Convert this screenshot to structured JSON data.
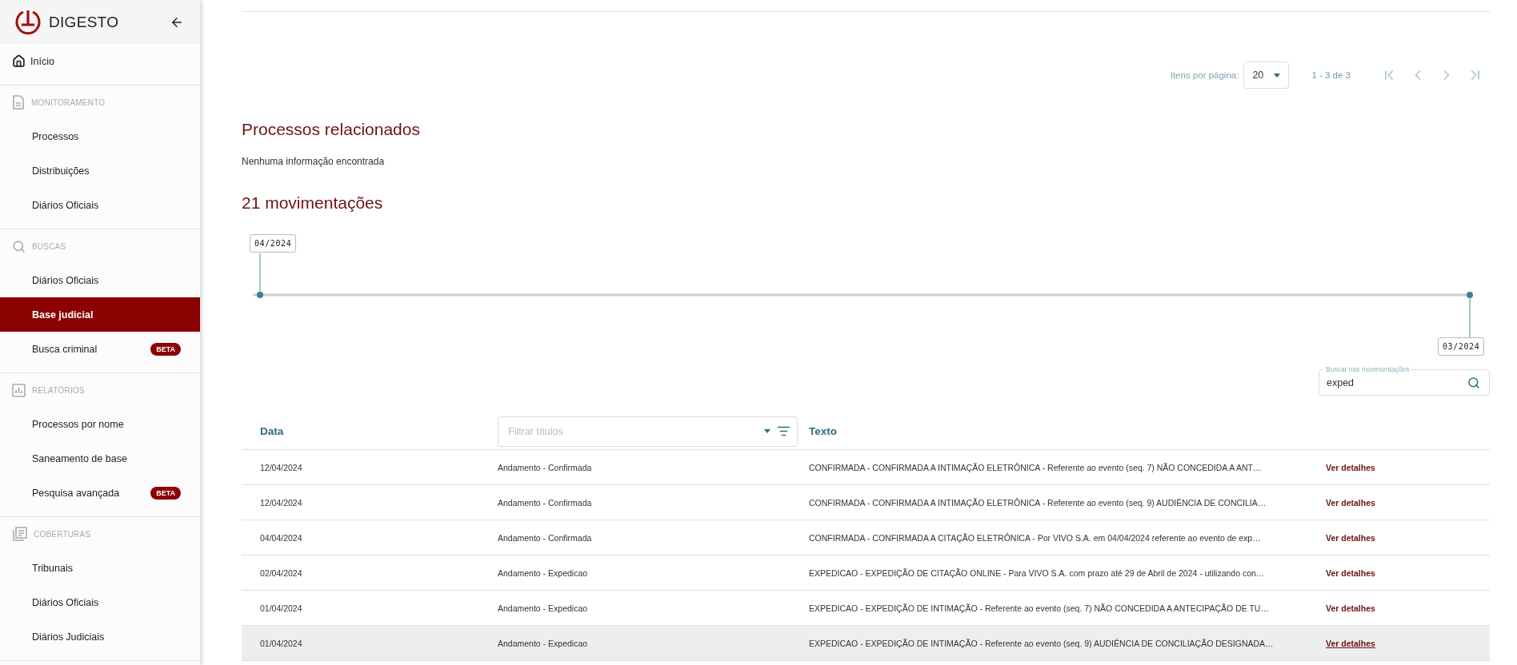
{
  "sidebar": {
    "brand": "DIGESTO",
    "home": {
      "label": "Início",
      "selected": false
    },
    "sections": [
      {
        "title": "MONITORAMENTO",
        "items": [
          {
            "label": "Processos",
            "selected": false
          },
          {
            "label": "Distribuições",
            "selected": false
          },
          {
            "label": "Diários Oficiais",
            "selected": false
          }
        ]
      },
      {
        "title": "BUSCAS",
        "items": [
          {
            "label": "Diários Oficiais",
            "selected": false
          },
          {
            "label": "Base judicial",
            "selected": true
          },
          {
            "label": "Busca criminal",
            "selected": false,
            "badge": "BETA"
          }
        ]
      },
      {
        "title": "RELATÓRIOS",
        "items": [
          {
            "label": "Processos por nome",
            "selected": false
          },
          {
            "label": "Saneamento de base",
            "selected": false
          },
          {
            "label": "Pesquisa avançada",
            "selected": false,
            "badge": "BETA"
          }
        ]
      },
      {
        "title": "COBERTURAS",
        "items": [
          {
            "label": "Tribunais",
            "selected": false
          },
          {
            "label": "Diários Oficiais",
            "selected": false
          },
          {
            "label": "Diários Judiciais",
            "selected": false
          }
        ]
      }
    ]
  },
  "pagination": {
    "label": "Itens por página:",
    "page_size": "20",
    "range": "1 - 3 de 3"
  },
  "related": {
    "title": "Processos relacionados",
    "empty_text": "Nenhuma informação encontrada"
  },
  "movements": {
    "title": "21 movimentações",
    "timeline": {
      "start_label": "04/2024",
      "end_label": "03/2024"
    },
    "search": {
      "label": "Buscar nas movimentações",
      "value": "exped"
    },
    "table": {
      "date_column": "Data",
      "filter_placeholder": "Filtrar títulos",
      "text_column": "Texto",
      "rows": [
        {
          "date": "12/04/2024",
          "title": "Andamento - Confirmada",
          "text": "CONFIRMADA - CONFIRMADA A INTIMAÇÃO ELETRÔNICA - Referente ao evento (seq. 7) NÃO CONCEDIDA A ANT…",
          "link": "Ver detalhes",
          "hovered": false
        },
        {
          "date": "12/04/2024",
          "title": "Andamento - Confirmada",
          "text": "CONFIRMADA - CONFIRMADA A INTIMAÇÃO ELETRÔNICA - Referente ao evento (seq. 9) AUDIÊNCIA DE CONCILIA…",
          "link": "Ver detalhes",
          "hovered": false
        },
        {
          "date": "04/04/2024",
          "title": "Andamento - Confirmada",
          "text": "CONFIRMADA - CONFIRMADA A CITAÇÃO ELETRÔNICA - Por VIVO S.A. em 04/04/2024 referente ao evento de exp…",
          "link": "Ver detalhes",
          "hovered": false
        },
        {
          "date": "02/04/2024",
          "title": "Andamento - Expedicao",
          "text": "EXPEDICAO - EXPEDIÇÃO DE CITAÇÃO ONLINE - Para VIVO S.A. com prazo até 29 de Abril de 2024 - utilizando con…",
          "link": "Ver detalhes",
          "hovered": false
        },
        {
          "date": "01/04/2024",
          "title": "Andamento - Expedicao",
          "text": "EXPEDICAO - EXPEDIÇÃO DE INTIMAÇÃO - Referente ao evento (seq. 7) NÃO CONCEDIDA A ANTECIPAÇÃO DE TU…",
          "link": "Ver detalhes",
          "hovered": false
        },
        {
          "date": "01/04/2024",
          "title": "Andamento - Expedicao",
          "text": "EXPEDICAO - EXPEDIÇÃO DE INTIMAÇÃO - Referente ao evento (seq. 9) AUDIÊNCIA DE CONCILIAÇÃO DESIGNADA…",
          "link": "Ver detalhes",
          "hovered": true
        }
      ]
    }
  }
}
